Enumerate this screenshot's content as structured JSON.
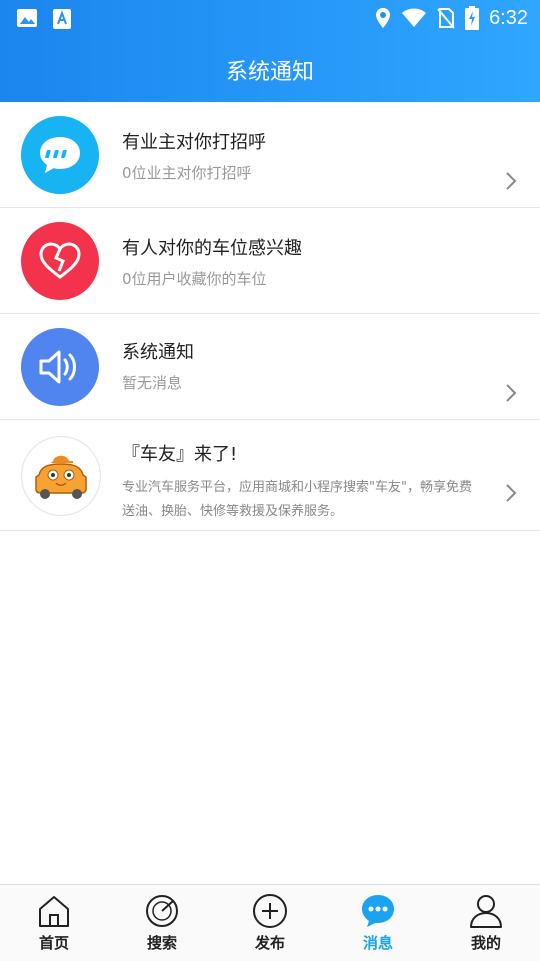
{
  "status_bar": {
    "time": "6:32"
  },
  "header": {
    "title": "系统通知"
  },
  "notifications": [
    {
      "title": "有业主对你打招呼",
      "subtitle": "0位业主对你打招呼",
      "icon": "chat-bubble-icon",
      "color": "#17b3f2"
    },
    {
      "title": "有人对你的车位感兴趣",
      "subtitle": "0位用户收藏你的车位",
      "icon": "broken-heart-icon",
      "color": "#f2334b"
    },
    {
      "title": "系统通知",
      "subtitle": "暂无消息",
      "icon": "speaker-icon",
      "color": "#5085f0"
    },
    {
      "title": "『车友』来了!",
      "subtitle": "专业汽车服务平台，应用商城和小程序搜索\"车友\"，畅享免费送油、换胎、快修等救援及保养服务。",
      "icon": "car-mascot-icon",
      "color": "#f08a1c"
    }
  ],
  "tabbar": {
    "active": "消息",
    "accent": "#1aa3ef",
    "items": [
      {
        "label": "首页",
        "icon": "home-icon"
      },
      {
        "label": "搜索",
        "icon": "search-icon"
      },
      {
        "label": "发布",
        "icon": "add-icon"
      },
      {
        "label": "消息",
        "icon": "message-icon"
      },
      {
        "label": "我的",
        "icon": "profile-icon"
      }
    ]
  }
}
